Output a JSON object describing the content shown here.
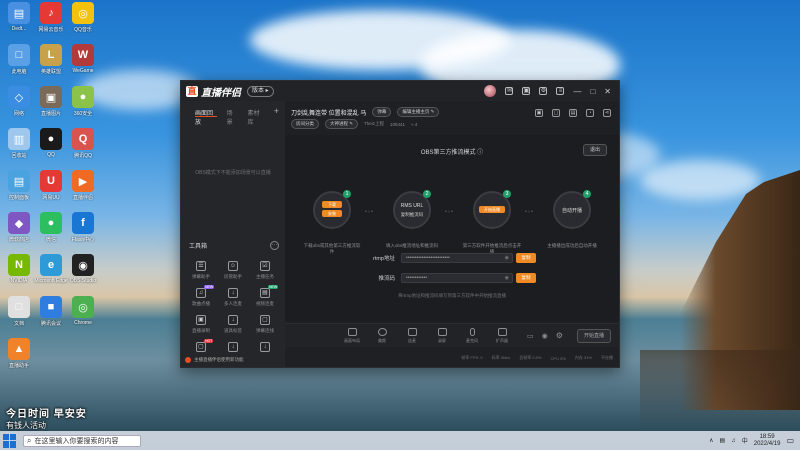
{
  "desktop": {
    "icons": [
      {
        "label": "Dedt...",
        "color": "#4a90e2",
        "glyph": "▤"
      },
      {
        "label": "网易云音乐",
        "color": "#e53935",
        "glyph": "♪"
      },
      {
        "label": "QQ音乐",
        "color": "#f4c20d",
        "glyph": "◎"
      },
      {
        "label": "此电脑",
        "color": "#5aa0e6",
        "glyph": "□"
      },
      {
        "label": "英雄联盟",
        "color": "#c8a24a",
        "glyph": "L"
      },
      {
        "label": "WeGame",
        "color": "#b33a3a",
        "glyph": "W"
      },
      {
        "label": "网络",
        "color": "#3a8de0",
        "glyph": "◇"
      },
      {
        "label": "直播图片",
        "color": "#7a6a5a",
        "glyph": "▣"
      },
      {
        "label": "360安全",
        "color": "#8bc34a",
        "glyph": "●"
      },
      {
        "label": "回收站",
        "color": "#9ec7ee",
        "glyph": "▥"
      },
      {
        "label": "QQ",
        "color": "#1a1a1a",
        "glyph": "●"
      },
      {
        "label": "腾讯QQ",
        "color": "#d9534f",
        "glyph": "Q"
      },
      {
        "label": "控制面板",
        "color": "#4aa3df",
        "glyph": "▤"
      },
      {
        "label": "网易UU",
        "color": "#e53935",
        "glyph": "U"
      },
      {
        "label": "直播伴侣",
        "color": "#f06a24",
        "glyph": "▶"
      },
      {
        "label": "微软商店",
        "color": "#7e57c2",
        "glyph": "◆"
      },
      {
        "label": "微信",
        "color": "#2dbe60",
        "glyph": "●"
      },
      {
        "label": "Flash中心",
        "color": "#1976d2",
        "glyph": "f"
      },
      {
        "label": "NVIDIA",
        "color": "#76b900",
        "glyph": "N"
      },
      {
        "label": "Microsoft Edge",
        "color": "#2d9bd8",
        "glyph": "e"
      },
      {
        "label": "OBS Studio",
        "color": "#222",
        "glyph": "◉"
      },
      {
        "label": "文档",
        "color": "#e0e0e0",
        "glyph": "□"
      },
      {
        "label": "腾讯会议",
        "color": "#2f7de1",
        "glyph": "■"
      },
      {
        "label": "Chrome",
        "color": "#4caf50",
        "glyph": "◎"
      },
      {
        "label": "直播助手",
        "color": "#f0832a",
        "glyph": "▲"
      }
    ],
    "overlay_lines": [
      "今日时间 早安安",
      "有钱人活动"
    ]
  },
  "app": {
    "name": "直播伴侣",
    "version": "版本 ▸",
    "left_tabs": [
      "画面回放",
      "场景",
      "素材库"
    ],
    "left_plus": "+",
    "no_scene_text": "OBS模式下不能添加场景可以直播",
    "toolbox_title": "工具箱",
    "toolbox_more": "···",
    "tools": [
      {
        "label": "弹幕助手",
        "glyph": "☰",
        "badge": ""
      },
      {
        "label": "房管助手",
        "glyph": "☺",
        "badge": ""
      },
      {
        "label": "主播任务",
        "glyph": "☑",
        "badge": ""
      },
      {
        "label": "歌曲点播",
        "glyph": "♫",
        "badge": "NEW"
      },
      {
        "label": "多人连麦",
        "glyph": "↓",
        "badge": ""
      },
      {
        "label": "视频连麦",
        "glyph": "▤",
        "badge": "NEW"
      },
      {
        "label": "直播录制",
        "glyph": "▣",
        "badge": ""
      },
      {
        "label": "道具标签",
        "glyph": "↓",
        "badge": ""
      },
      {
        "label": "弹幕连线",
        "glyph": "▢",
        "badge": ""
      },
      {
        "label": "",
        "glyph": "▢",
        "badge": "HOT"
      },
      {
        "label": "",
        "glyph": "↓",
        "badge": ""
      },
      {
        "label": "",
        "glyph": "↓",
        "badge": ""
      }
    ],
    "left_bottom_text": "主播直播伴侣使用新功能",
    "room_title": "刀剑乱舞连带 位置和混乱 马",
    "pills": [
      "弹幕",
      "编辑主播主页 ✎"
    ],
    "info2": [
      "房间分类",
      "大神进程 ✎",
      "Theiz上程",
      "105441",
      "≈ 4"
    ],
    "mode_title": "OBS第三方推流模式 ⓘ",
    "exit_label": "退出",
    "steps": [
      {
        "num": "1",
        "inner": "",
        "btn1": "下载",
        "btn2": "安装",
        "desc": "下载obs或其他第三方推流软件"
      },
      {
        "num": "2",
        "inner": "RMS URL",
        "btn1": "",
        "btn2": "",
        "desc": "填入obs推流地址和推流码",
        "sub": "复制推流码"
      },
      {
        "num": "3",
        "inner": "",
        "btn1": "开始直播",
        "btn2": "",
        "desc": "第三方软件开始推流后点击开播"
      },
      {
        "num": "4",
        "inner": "自动开播",
        "btn1": "",
        "btn2": "",
        "desc": "主播播出成功后自动开播"
      }
    ],
    "rtmp_label": "rtmp地址",
    "rtmp_value": "•••••••••••••••••••••••••",
    "key_label": "推流码",
    "key_value": "••••••••••••",
    "copy_label": "复制",
    "hint": "将rtmp地址和推流码填写到第三方软件中开始推流直播",
    "bottom_tools": [
      "画面布局",
      "美颜",
      "连麦",
      "录屏",
      "麦克风",
      "扩声器"
    ],
    "golive": "开始直播",
    "status": [
      "帧率 FPS: 0",
      "码率 0kb/s",
      "丢帧率 0.0%",
      "CPU 5%",
      "内存 31%",
      "不在播"
    ]
  },
  "taskbar": {
    "search_text": "在这里输入你要搜索的内容",
    "time": "18:59",
    "date": "2022/4/19",
    "tray": [
      "∧",
      "▤",
      "♫",
      "中"
    ]
  }
}
